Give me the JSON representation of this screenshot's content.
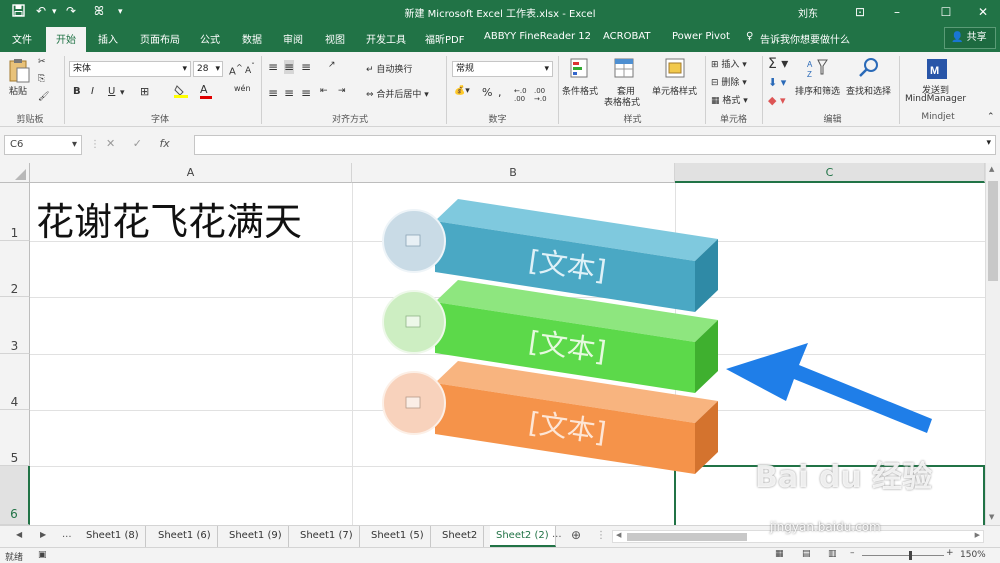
{
  "titlebar": {
    "title": "新建 Microsoft Excel 工作表.xlsx  -  Excel",
    "user": "刘东",
    "qa_save_icon": "save-icon",
    "qa_undo": "↶",
    "qa_redo": "↷",
    "qa_custom": "ꕤ"
  },
  "tabs": [
    "文件",
    "开始",
    "插入",
    "页面布局",
    "公式",
    "数据",
    "审阅",
    "视图",
    "开发工具",
    "福昕PDF",
    "ABBYY FineReader 12",
    "ACROBAT",
    "Power Pivot"
  ],
  "active_tab": "开始",
  "tellme": "告诉我你想要做什么",
  "share": "共享",
  "ribbon": {
    "paste": "粘贴",
    "clipboard_group": "剪贴板",
    "font_name": "宋体",
    "font_size": "28",
    "font_group": "字体",
    "wrap_text": "自动换行",
    "merge_center": "合并后居中",
    "align_group": "对齐方式",
    "number_format": "常规",
    "number_group": "数字",
    "conditional_format": "条件格式",
    "table_format_1": "套用",
    "table_format_2": "表格格式",
    "cell_style": "单元格样式",
    "styles_group": "样式",
    "insert": "插入",
    "delete": "删除",
    "format": "格式",
    "cells_group": "单元格",
    "sort_filter": "排序和筛选",
    "find_select": "查找和选择",
    "edit_group": "编辑",
    "send_to_1": "发送到",
    "send_to_2": "MindManager",
    "mindjet_group": "Mindjet",
    "bold": "B",
    "italic": "I",
    "underline": "U",
    "percent": "%"
  },
  "formula": {
    "name_box": "C6",
    "fx": "fx",
    "value": ""
  },
  "sheet": {
    "columns": [
      "A",
      "B",
      "C"
    ],
    "rows": [
      "1",
      "2",
      "3",
      "4",
      "5",
      "6"
    ],
    "selected_col": "C",
    "selected_row": "6",
    "a1_text": "花谢花飞花满天"
  },
  "smartart": {
    "items": [
      "[文本]",
      "[文本]",
      "[文本]"
    ],
    "colors": [
      "#4aa8c4",
      "#5cd94a",
      "#f5934a"
    ],
    "circle_colors": [
      "#c9dbe6",
      "#cdeec2",
      "#f8d2bc"
    ],
    "arrow_color": "#1f7ee8"
  },
  "sheet_tabs": [
    "Sheet1 (8)",
    "Sheet1 (6)",
    "Sheet1 (9)",
    "Sheet1 (7)",
    "Sheet1 (5)",
    "Sheet2",
    "Sheet2 (2)"
  ],
  "active_sheet": "Sheet2 (2)",
  "status": {
    "mode": "就绪",
    "zoom": "150%"
  },
  "watermark": {
    "text": "Bai du 经验",
    "url": "jingyan.baidu.com"
  }
}
